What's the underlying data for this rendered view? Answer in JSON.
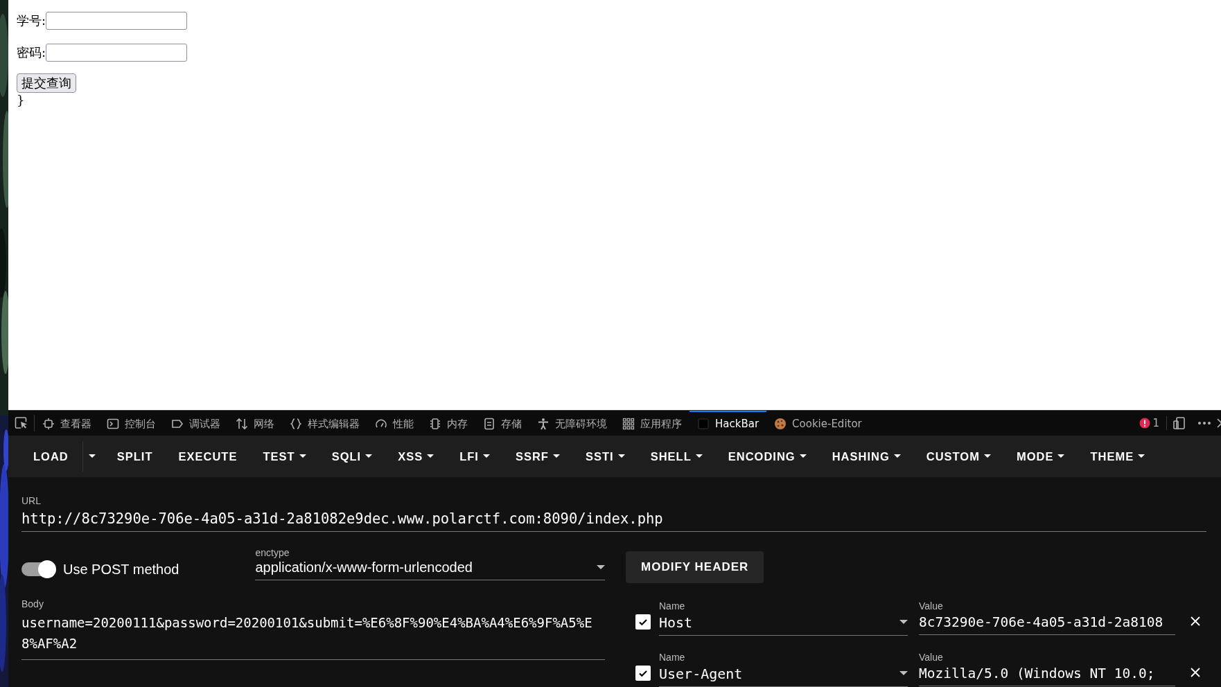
{
  "page": {
    "fields": [
      {
        "label": "学号:"
      },
      {
        "label": "密码:"
      }
    ],
    "submit": "提交查询",
    "trailing_text": "}"
  },
  "devtools": {
    "tabs": [
      {
        "kind": "inspector",
        "label": "查看器",
        "selected": false
      },
      {
        "kind": "console",
        "label": "控制台",
        "selected": false
      },
      {
        "kind": "debugger",
        "label": "调试器",
        "selected": false
      },
      {
        "kind": "network",
        "label": "网络",
        "selected": false
      },
      {
        "kind": "style",
        "label": "样式编辑器",
        "selected": false
      },
      {
        "kind": "performance",
        "label": "性能",
        "selected": false
      },
      {
        "kind": "memory",
        "label": "内存",
        "selected": false
      },
      {
        "kind": "storage",
        "label": "存储",
        "selected": false
      },
      {
        "kind": "accessibility",
        "label": "无障碍环境",
        "selected": false
      },
      {
        "kind": "application",
        "label": "应用程序",
        "selected": false
      },
      {
        "kind": "hackbar",
        "label": "HackBar",
        "selected": true
      },
      {
        "kind": "cookie",
        "label": "Cookie-Editor",
        "selected": false
      }
    ],
    "error_count": "1"
  },
  "hackbar": {
    "menu": [
      {
        "label": "LOAD",
        "kind": "split"
      },
      {
        "label": "SPLIT",
        "kind": "plain"
      },
      {
        "label": "EXECUTE",
        "kind": "plain"
      },
      {
        "label": "TEST",
        "kind": "menu"
      },
      {
        "label": "SQLI",
        "kind": "menu"
      },
      {
        "label": "XSS",
        "kind": "menu"
      },
      {
        "label": "LFI",
        "kind": "menu"
      },
      {
        "label": "SSRF",
        "kind": "menu"
      },
      {
        "label": "SSTI",
        "kind": "menu"
      },
      {
        "label": "SHELL",
        "kind": "menu"
      },
      {
        "label": "ENCODING",
        "kind": "menu"
      },
      {
        "label": "HASHING",
        "kind": "menu"
      },
      {
        "label": "CUSTOM",
        "kind": "menu"
      },
      {
        "label": "MODE",
        "kind": "menu"
      },
      {
        "label": "THEME",
        "kind": "menu"
      }
    ],
    "url": {
      "label": "URL",
      "value": "http://8c73290e-706e-4a05-a31d-2a81082e9dec.www.polarctf.com:8090/index.php"
    },
    "post_method": {
      "label": "Use POST method",
      "on": true
    },
    "enctype": {
      "label": "enctype",
      "value": "application/x-www-form-urlencoded"
    },
    "body": {
      "label": "Body",
      "value": "username=20200111&password=20200101&submit=%E6%8F%90%E4%BA%A4%E6%9F%A5%E8%AF%A2"
    },
    "modify_header": "MODIFY HEADER",
    "headers": [
      {
        "checked": true,
        "name_label": "Name",
        "name": "Host",
        "value_label": "Value",
        "value": "8c73290e-706e-4a05-a31d-2a8108"
      },
      {
        "checked": true,
        "name_label": "Name",
        "name": "User-Agent",
        "value_label": "Value",
        "value": "Mozilla/5.0 (Windows NT 10.0;"
      }
    ]
  }
}
